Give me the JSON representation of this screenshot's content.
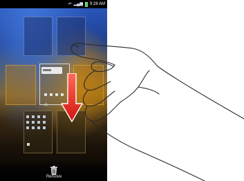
{
  "status_bar": {
    "time": "9:28 AM",
    "icons": [
      "usb-icon",
      "signal-icon",
      "battery-icon"
    ]
  },
  "home_pages": {
    "count": 7,
    "layout": "2-3-2 grid of home screen page thumbnails"
  },
  "bottom_bar": {
    "remove_label": "Remove",
    "remove_icon": "trash-icon"
  },
  "gesture": {
    "type": "drag",
    "direction": "down",
    "arrow_color": "#e8231f",
    "hand_icon": "hand-pointer-icon"
  },
  "colors": {
    "accent_arrow": "#e8231f",
    "status_bar_bg": "#000000",
    "battery": "#3dd13d"
  }
}
